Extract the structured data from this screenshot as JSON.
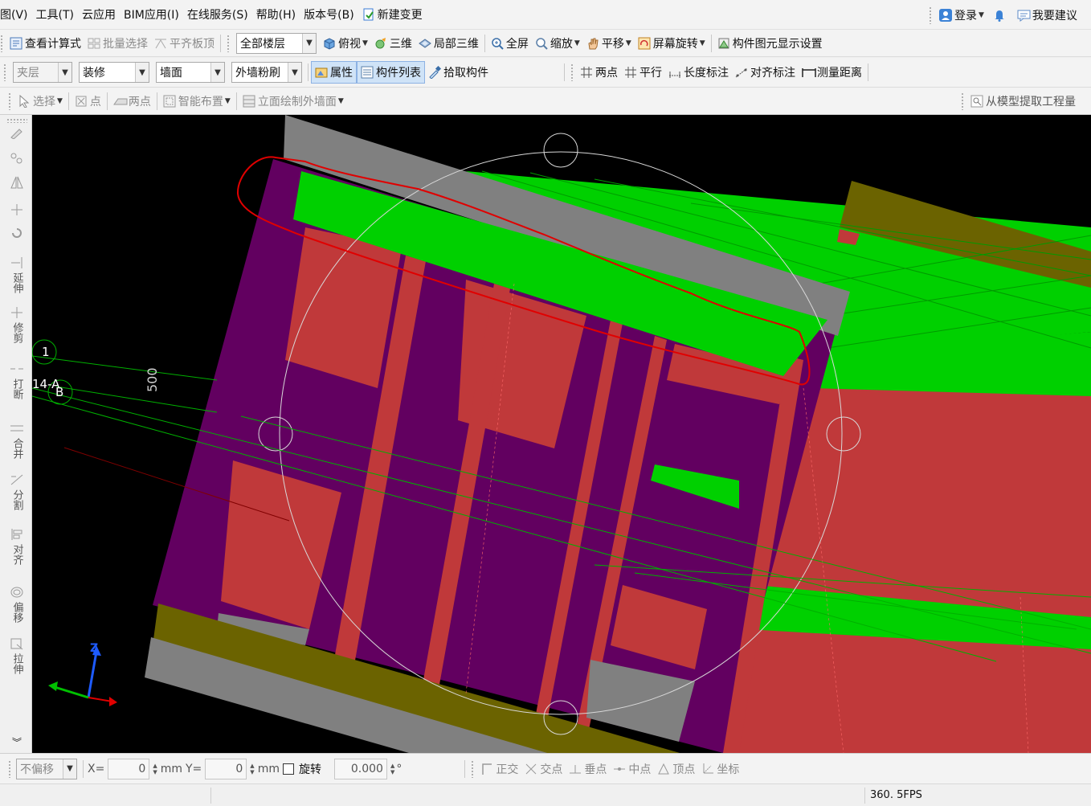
{
  "menubar": {
    "items": [
      "图(V)",
      "工具(T)",
      "云应用",
      "BIM应用(I)",
      "在线服务(S)",
      "帮助(H)",
      "版本号(B)"
    ],
    "new_change": "新建变更",
    "login": "登录",
    "feedback": "我要建议"
  },
  "toolbar1": {
    "view_formula": "查看计算式",
    "batch_select": "批量选择",
    "align_top": "平齐板顶",
    "floor_select": "全部楼层",
    "top_view": "俯视",
    "three_d": "三维",
    "local_3d": "局部三维",
    "fullscreen": "全屏",
    "zoom": "缩放",
    "pan": "平移",
    "screen_rotate": "屏幕旋转",
    "display_settings": "构件图元显示设置"
  },
  "toolbar2": {
    "layer_combo": "夹层",
    "category_combo": "装修",
    "type_combo": "墙面",
    "component_combo": "外墙粉刷",
    "properties": "属性",
    "component_list": "构件列表",
    "pick_component": "拾取构件",
    "two_points": "两点",
    "parallel": "平行",
    "length_dim": "长度标注",
    "aligned_dim": "对齐标注",
    "measure_distance": "测量距离"
  },
  "toolbar3": {
    "select": "选择",
    "point": "点",
    "two_points": "两点",
    "smart_layout": "智能布置",
    "draw_elevation": "立面绘制外墙面",
    "extract_quantity": "从模型提取工程量"
  },
  "lefttools": {
    "extend": "延伸",
    "trim": "修剪",
    "break": "打断",
    "merge": "合并",
    "split": "分割",
    "align": "对齐",
    "offset": "偏移",
    "stretch": "拉伸"
  },
  "viewport": {
    "axis_label_1": "1",
    "axis_label_14a": "14-A",
    "axis_label_b": "B",
    "dim_text": "500",
    "axis_z": "Z",
    "colors": {
      "background": "#000000",
      "wall_purple": "#620060",
      "floor_red": "#c0393a",
      "slab_green": "#00d000",
      "beam_gray": "#808080",
      "olive": "#6b6300",
      "annotation_red": "#e00000"
    }
  },
  "statusbar": {
    "offset_mode": "不偏移",
    "x_label": "X=",
    "x_value": "0",
    "x_unit": "mm",
    "y_label": "Y=",
    "y_value": "0",
    "y_unit": "mm",
    "rotate_label": "旋转",
    "rotate_value": "0.000",
    "degree": "°",
    "snap_ortho": "正交",
    "snap_intersection": "交点",
    "snap_perpendicular": "垂点",
    "snap_midpoint": "中点",
    "snap_vertex": "顶点",
    "snap_coordinate": "坐标"
  },
  "bottombar": {
    "fps": "360. 5FPS"
  }
}
